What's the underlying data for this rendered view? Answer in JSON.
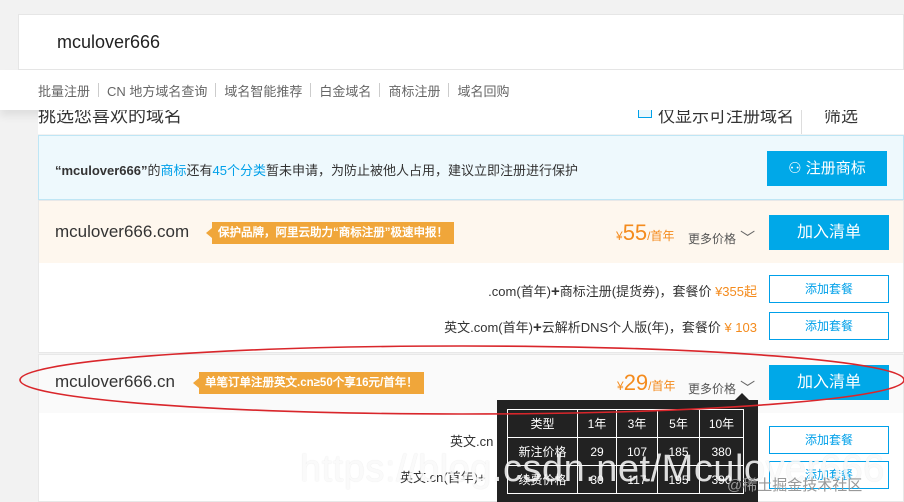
{
  "search": {
    "value": "mculover666"
  },
  "nav": {
    "items": [
      "批量注册",
      "CN 地方域名查询",
      "域名智能推荐",
      "白金域名",
      "商标注册",
      "域名回购"
    ]
  },
  "filter": {
    "title": "挑选您喜欢的域名",
    "checkbox_label": "仅显示可注册域名",
    "select_label": "筛选"
  },
  "notice": {
    "quote_name": "“mculover666”",
    "t1": "的",
    "link1": "商标",
    "t2": "还有",
    "link2": "45个分类",
    "t3": "暂未申请，为防止被他人占用，建议立即注册进行保护",
    "button": "注册商标"
  },
  "domains": [
    {
      "name": "mculover666.com",
      "badge": "保护品牌，阿里云助力“商标注册”极速申报！",
      "currency": "¥",
      "price": "55",
      "unit": "/首年",
      "more": "更多价格",
      "add": "加入清单",
      "packages": [
        {
          "text_a": ".com(首年)",
          "plus": "+",
          "text_b": "商标注册(提货券)，套餐价",
          "price": "¥355起",
          "button": "添加套餐"
        },
        {
          "text_a": "英文.com(首年)",
          "plus": "+",
          "text_b": "云解析DNS个人版(年)，套餐价",
          "price": "¥ 103",
          "button": "添加套餐"
        }
      ]
    },
    {
      "name": "mculover666.cn",
      "badge": "单笔订单注册英文.cn≥50个享16元/首年！",
      "currency": "¥",
      "price": "29",
      "unit": "/首年",
      "more": "更多价格",
      "add": "加入清单",
      "packages": [
        {
          "text_a": "英文.cn",
          "button": "添加套餐"
        },
        {
          "text_a": "英文.cn(首年)+",
          "button": "添加套餐"
        }
      ]
    }
  ],
  "price_table": {
    "header": [
      "类型",
      "1年",
      "3年",
      "5年",
      "10年"
    ],
    "rows": [
      [
        "新注价格",
        "29",
        "107",
        "185",
        "380"
      ],
      [
        "续费价格",
        "30",
        "117",
        "195",
        "390"
      ]
    ]
  },
  "watermark": {
    "url": "https://blog.csdn.net/Mculover666",
    "community": "@稀土掘金技术社区"
  },
  "colors": {
    "accent": "#00a8e8",
    "price": "#f48b1d",
    "badge": "#f0a63a",
    "annotation": "#d9262b"
  }
}
